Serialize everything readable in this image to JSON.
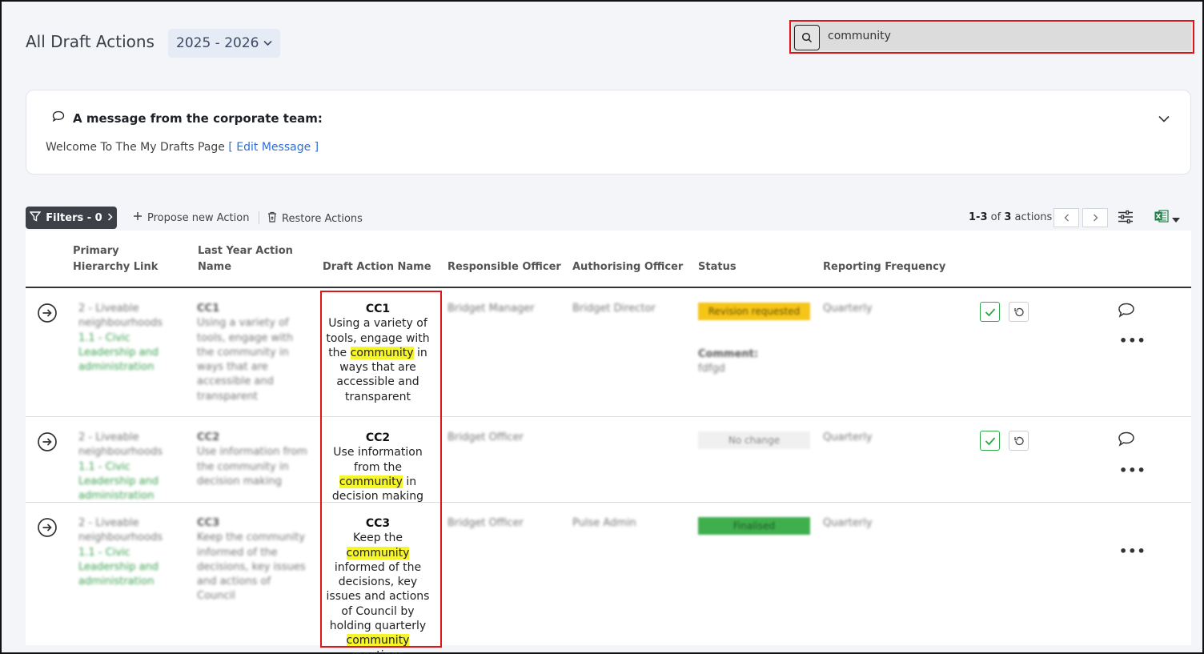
{
  "header": {
    "title": "All Draft Actions",
    "year": "2025 - 2026",
    "search_value": "community"
  },
  "message": {
    "title": "A message from the corporate team:",
    "body": "Welcome To The My Drafts Page",
    "edit_link": "[ Edit Message ]"
  },
  "toolbar": {
    "filters_label": "Filters - 0",
    "propose_label": "Propose new Action",
    "restore_label": "Restore Actions",
    "range": "1-3",
    "of": "of",
    "total": "3",
    "unit": "actions"
  },
  "columns": {
    "primary": "Primary Hierarchy Link",
    "last_year": "Last Year Action Name",
    "draft": "Draft Action Name",
    "responsible": "Responsible Officer",
    "authorising": "Authorising Officer",
    "status": "Status",
    "frequency": "Reporting Frequency"
  },
  "rows": [
    {
      "hierarchy_1": "2 - Liveable neighbourhoods",
      "hierarchy_2": "1.1 - Civic Leadership and administration",
      "ly_code": "CC1",
      "ly_name": "Using a variety of tools, engage with the community in ways that are accessible and transparent",
      "draft_code": "CC1",
      "draft_pre": "Using a variety of tools, engage with the",
      "draft_hl": "community",
      "draft_post": "in ways that are accessible and transparent",
      "responsible": "Bridget Manager",
      "authorising": "Bridget Director",
      "status": "Revision requested",
      "comment_label": "Comment:",
      "comment": "fdfgd",
      "frequency": "Quarterly"
    },
    {
      "hierarchy_1": "2 - Liveable neighbourhoods",
      "hierarchy_2": "1.1 - Civic Leadership and administration",
      "ly_code": "CC2",
      "ly_name": "Use information from the community in decision making",
      "draft_code": "CC2",
      "draft_pre": "Use information from the",
      "draft_hl": "community",
      "draft_post": "in decision making",
      "responsible": "Bridget Officer",
      "authorising": "",
      "status": "No change",
      "frequency": "Quarterly"
    },
    {
      "hierarchy_1": "2 - Liveable neighbourhoods",
      "hierarchy_2": "1.1 - Civic Leadership and administration",
      "ly_code": "CC3",
      "ly_name": "Keep the community informed of the decisions, key issues and actions of Council",
      "draft_code": "CC3",
      "draft_pre": "Keep the",
      "draft_hl": "community",
      "draft_mid": "informed of the decisions, key issues and actions of Council by holding quarterly",
      "draft_hl2": "community",
      "draft_post": "meetings",
      "responsible": "Bridget Officer",
      "authorising": "Pulse Admin",
      "status": "Finalised",
      "frequency": "Quarterly"
    }
  ],
  "colors": {
    "highlight": "#f5f52a",
    "annotation_red": "#e01515",
    "revision": "#f5c518",
    "finalised": "#3fae4d"
  }
}
